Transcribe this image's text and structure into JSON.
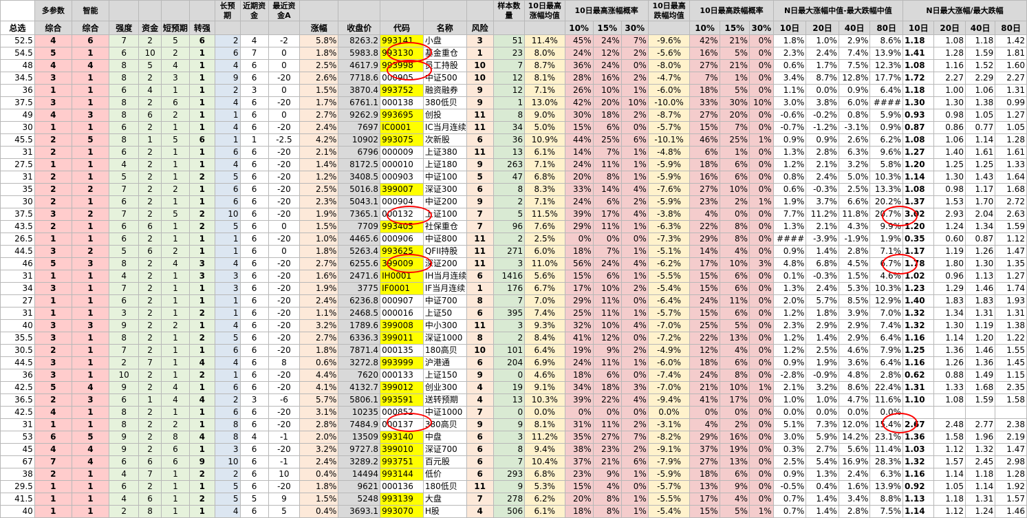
{
  "header": {
    "duo": "多参数",
    "zhineng": "智能",
    "changyuqi": "长预期",
    "jinqizijin": "近期资金",
    "zuijinzijin": "最近资金A",
    "zhangfu": "涨幅",
    "shoupanjia": "收盘价",
    "daima": "代码",
    "mingcheng": "名称",
    "fengxian": "风险",
    "yangben": "样本数量",
    "max_avg": "10日最高涨幅均值",
    "max_prob": "10日最高涨幅概率",
    "min_avg": "10日最高跌幅均值",
    "min_prob": "10日最高跌幅概率",
    "median": "N日最大涨幅中值-最大跌幅中值",
    "ratio": "N日最大涨幅/最大跌幅",
    "zongxuan": "总选",
    "zonghe": "综合",
    "qiangdu": "强度",
    "zijin": "资金",
    "duanyuqi": "短预期",
    "zhuanqiang": "转强",
    "p10": "10%",
    "p15": "15%",
    "p30": "30%",
    "d10": "10日",
    "d20": "20日",
    "d40": "40日",
    "d80": "80日"
  },
  "rows": [
    [
      "52.5",
      "4",
      "6",
      "7",
      "2",
      "5",
      "6",
      "2",
      "4",
      "-2",
      "5.8%",
      "8263.2",
      "993141",
      "小盘",
      "3",
      "51",
      "11.4%",
      "45%",
      "24%",
      "7%",
      "-9.6%",
      "42%",
      "21%",
      "0%",
      "1.8%",
      "1.0%",
      "2.9%",
      "8.6%",
      "1.18",
      "1.08",
      "1.18",
      "1.42"
    ],
    [
      "54.5",
      "5",
      "1",
      "6",
      "10",
      "2",
      "1",
      "6",
      "7",
      "0",
      "1.8%",
      "5983.8",
      "993130",
      "基金重仓",
      "1",
      "23",
      "8.0%",
      "24%",
      "12%",
      "2%",
      "-5.6%",
      "16%",
      "5%",
      "0%",
      "2.3%",
      "2.4%",
      "7.4%",
      "13.9%",
      "1.41",
      "1.28",
      "1.59",
      "1.81"
    ],
    [
      "48",
      "4",
      "4",
      "8",
      "5",
      "4",
      "1",
      "4",
      "6",
      "0",
      "2.5%",
      "4617.9",
      "993998",
      "员工持股",
      "10",
      "7",
      "8.7%",
      "36%",
      "24%",
      "0%",
      "-8.0%",
      "27%",
      "21%",
      "0%",
      "0.6%",
      "1.7%",
      "7.5%",
      "12.3%",
      "1.08",
      "1.16",
      "1.52",
      "1.60"
    ],
    [
      "34.5",
      "3",
      "1",
      "8",
      "2",
      "3",
      "1",
      "9",
      "6",
      "-20",
      "2.6%",
      "7718.6",
      "000905",
      "中证500",
      "10",
      "12",
      "8.1%",
      "28%",
      "16%",
      "2%",
      "-4.7%",
      "7%",
      "1%",
      "0%",
      "3.4%",
      "8.7%",
      "12.8%",
      "17.7%",
      "1.72",
      "2.27",
      "2.29",
      "2.27"
    ],
    [
      "36",
      "1",
      "1",
      "6",
      "4",
      "1",
      "1",
      "2",
      "3",
      "0",
      "1.5%",
      "3870.4",
      "993752",
      "融资融券",
      "9",
      "12",
      "7.1%",
      "26%",
      "10%",
      "1%",
      "-6.0%",
      "18%",
      "5%",
      "0%",
      "1.1%",
      "0.0%",
      "0.9%",
      "6.4%",
      "1.18",
      "1.00",
      "1.06",
      "1.31"
    ],
    [
      "37.5",
      "3",
      "1",
      "8",
      "2",
      "6",
      "1",
      "4",
      "6",
      "-20",
      "1.7%",
      "6761.1",
      "000138",
      "380低贝",
      "9",
      "1",
      "13.0%",
      "42%",
      "20%",
      "10%",
      "-10.0%",
      "33%",
      "30%",
      "10%",
      "3.0%",
      "3.8%",
      "6.0%",
      "####",
      "1.30",
      "1.30",
      "1.38",
      "0.99"
    ],
    [
      "49",
      "4",
      "3",
      "8",
      "6",
      "2",
      "1",
      "1",
      "6",
      "0",
      "2.7%",
      "9262.9",
      "993695",
      "创投",
      "11",
      "8",
      "9.0%",
      "30%",
      "18%",
      "2%",
      "-8.7%",
      "27%",
      "20%",
      "0%",
      "-0.6%",
      "-0.2%",
      "0.8%",
      "5.9%",
      "0.93",
      "0.98",
      "1.05",
      "1.27"
    ],
    [
      "30",
      "1",
      "1",
      "6",
      "2",
      "1",
      "1",
      "4",
      "6",
      "-20",
      "2.4%",
      "7697",
      "IC0001",
      "IC当月连续",
      "11",
      "34",
      "5.0%",
      "15%",
      "6%",
      "0%",
      "-5.7%",
      "15%",
      "7%",
      "0%",
      "-0.7%",
      "-1.2%",
      "-3.1%",
      "0.9%",
      "0.87",
      "0.86",
      "0.77",
      "1.05"
    ],
    [
      "45.5",
      "2",
      "5",
      "8",
      "1",
      "5",
      "6",
      "1",
      "1",
      "-2.5",
      "4.2%",
      "10902",
      "993075",
      "次新股",
      "6",
      "36",
      "10.9%",
      "44%",
      "25%",
      "6%",
      "-10.1%",
      "46%",
      "25%",
      "1%",
      "0.9%",
      "0.9%",
      "2.6%",
      "6.2%",
      "1.08",
      "1.06",
      "1.14",
      "1.28"
    ],
    [
      "31",
      "2",
      "1",
      "6",
      "2",
      "1",
      "1",
      "6",
      "6",
      "-20",
      "2.1%",
      "6796",
      "000009",
      "上证380",
      "11",
      "13",
      "6.1%",
      "14%",
      "7%",
      "1%",
      "-4.8%",
      "6%",
      "1%",
      "0%",
      "1.3%",
      "2.8%",
      "6.3%",
      "9.6%",
      "1.27",
      "1.40",
      "1.61",
      "1.61"
    ],
    [
      "27.5",
      "1",
      "1",
      "4",
      "2",
      "1",
      "1",
      "4",
      "6",
      "-20",
      "1.4%",
      "8172.5",
      "000010",
      "上证180",
      "9",
      "263",
      "7.1%",
      "24%",
      "11%",
      "1%",
      "-5.9%",
      "18%",
      "6%",
      "0%",
      "1.2%",
      "2.1%",
      "3.2%",
      "5.8%",
      "1.20",
      "1.25",
      "1.25",
      "1.33"
    ],
    [
      "31",
      "2",
      "1",
      "5",
      "2",
      "1",
      "2",
      "5",
      "6",
      "-20",
      "1.2%",
      "3408.5",
      "000903",
      "中证100",
      "5",
      "47",
      "6.8%",
      "20%",
      "8%",
      "1%",
      "-5.9%",
      "16%",
      "6%",
      "0%",
      "0.8%",
      "2.4%",
      "5.0%",
      "10.3%",
      "1.14",
      "1.30",
      "1.43",
      "1.64"
    ],
    [
      "35",
      "2",
      "2",
      "7",
      "2",
      "2",
      "1",
      "6",
      "6",
      "-20",
      "2.5%",
      "5016.8",
      "399007",
      "深证300",
      "6",
      "8",
      "8.3%",
      "33%",
      "14%",
      "4%",
      "-7.6%",
      "27%",
      "10%",
      "0%",
      "0.6%",
      "-0.3%",
      "2.5%",
      "13.3%",
      "1.08",
      "0.98",
      "1.17",
      "1.68"
    ],
    [
      "30",
      "2",
      "1",
      "6",
      "2",
      "1",
      "1",
      "6",
      "6",
      "-20",
      "2.3%",
      "5043.1",
      "000904",
      "中证200",
      "9",
      "2",
      "7.1%",
      "24%",
      "6%",
      "2%",
      "-5.9%",
      "23%",
      "2%",
      "1%",
      "1.9%",
      "3.7%",
      "6.6%",
      "20.2%",
      "1.37",
      "1.53",
      "1.70",
      "2.72"
    ],
    [
      "37.5",
      "3",
      "2",
      "7",
      "2",
      "5",
      "2",
      "10",
      "6",
      "-20",
      "1.9%",
      "7365.1",
      "000132",
      "上证100",
      "7",
      "5",
      "11.5%",
      "39%",
      "17%",
      "4%",
      "-3.8%",
      "4%",
      "0%",
      "0%",
      "7.7%",
      "11.2%",
      "11.8%",
      "20.7%",
      "3.02",
      "2.93",
      "2.04",
      "2.63"
    ],
    [
      "43.5",
      "2",
      "1",
      "6",
      "6",
      "1",
      "2",
      "5",
      "6",
      "0",
      "1.5%",
      "7709",
      "993405",
      "社保重仓",
      "7",
      "96",
      "7.6%",
      "29%",
      "11%",
      "1%",
      "-6.3%",
      "22%",
      "8%",
      "0%",
      "1.3%",
      "2.1%",
      "4.3%",
      "9.9%",
      "1.20",
      "1.24",
      "1.34",
      "1.59"
    ],
    [
      "26.5",
      "1",
      "1",
      "6",
      "2",
      "1",
      "1",
      "1",
      "6",
      "-20",
      "1.0%",
      "4465.6",
      "000906",
      "中证800",
      "11",
      "2",
      "2.5%",
      "0%",
      "0%",
      "0%",
      "-7.3%",
      "29%",
      "8%",
      "0%",
      "####",
      "-3.9%",
      "-1.9%",
      "1.9%",
      "0.35",
      "0.60",
      "0.87",
      "1.12"
    ],
    [
      "44.5",
      "3",
      "2",
      "5",
      "6",
      "2",
      "1",
      "1",
      "6",
      "0",
      "1.8%",
      "5263.4",
      "993625",
      "QFII持股",
      "11",
      "271",
      "6.0%",
      "18%",
      "7%",
      "1%",
      "-5.1%",
      "14%",
      "4%",
      "0%",
      "0.9%",
      "1.4%",
      "2.8%",
      "7.1%",
      "1.17",
      "1.19",
      "1.26",
      "1.47"
    ],
    [
      "46",
      "5",
      "3",
      "8",
      "2",
      "4",
      "3",
      "4",
      "6",
      "-20",
      "2.7%",
      "6255.6",
      "399009",
      "深证200",
      "11",
      "3",
      "11.0%",
      "56%",
      "24%",
      "4%",
      "-6.2%",
      "17%",
      "10%",
      "3%",
      "4.8%",
      "6.8%",
      "4.5%",
      "6.7%",
      "1.78",
      "1.80",
      "1.30",
      "1.35"
    ],
    [
      "31",
      "1",
      "1",
      "4",
      "2",
      "1",
      "3",
      "3",
      "6",
      "-20",
      "1.6%",
      "2471.6",
      "IH0001",
      "IH当月连续",
      "6",
      "1416",
      "5.6%",
      "15%",
      "6%",
      "1%",
      "-5.5%",
      "15%",
      "6%",
      "0%",
      "0.1%",
      "-0.3%",
      "1.5%",
      "4.6%",
      "1.02",
      "0.96",
      "1.13",
      "1.27"
    ],
    [
      "34",
      "3",
      "1",
      "7",
      "2",
      "1",
      "1",
      "3",
      "6",
      "-20",
      "1.9%",
      "3775",
      "IF0001",
      "IF当月连续",
      "1",
      "176",
      "6.7%",
      "17%",
      "10%",
      "2%",
      "-5.4%",
      "15%",
      "6%",
      "0%",
      "1.3%",
      "2.4%",
      "5.3%",
      "10.3%",
      "1.23",
      "1.29",
      "1.46",
      "1.74"
    ],
    [
      "27",
      "1",
      "1",
      "6",
      "2",
      "1",
      "1",
      "1",
      "6",
      "-20",
      "2.4%",
      "6236.8",
      "000907",
      "中证700",
      "8",
      "7",
      "7.0%",
      "29%",
      "11%",
      "0%",
      "-6.4%",
      "24%",
      "11%",
      "0%",
      "2.0%",
      "5.7%",
      "8.5%",
      "12.9%",
      "1.40",
      "1.83",
      "1.83",
      "1.93"
    ],
    [
      "31",
      "1",
      "1",
      "3",
      "2",
      "1",
      "2",
      "1",
      "6",
      "-20",
      "1.1%",
      "2468.5",
      "000016",
      "上证50",
      "6",
      "395",
      "7.4%",
      "25%",
      "11%",
      "1%",
      "-5.7%",
      "15%",
      "6%",
      "0%",
      "1.2%",
      "1.8%",
      "3.9%",
      "7.0%",
      "1.32",
      "1.34",
      "1.31",
      "1.31"
    ],
    [
      "40",
      "3",
      "3",
      "9",
      "2",
      "2",
      "1",
      "4",
      "6",
      "-20",
      "3.2%",
      "1789.6",
      "399008",
      "中小300",
      "11",
      "3",
      "9.3%",
      "32%",
      "10%",
      "4%",
      "-7.0%",
      "25%",
      "5%",
      "0%",
      "2.3%",
      "2.9%",
      "2.9%",
      "7.4%",
      "1.32",
      "1.30",
      "1.19",
      "1.38"
    ],
    [
      "35.5",
      "3",
      "1",
      "8",
      "2",
      "1",
      "2",
      "5",
      "6",
      "-20",
      "2.7%",
      "6336.3",
      "399011",
      "深证1000",
      "8",
      "2",
      "8.4%",
      "41%",
      "12%",
      "0%",
      "-7.2%",
      "22%",
      "13%",
      "0%",
      "1.2%",
      "1.4%",
      "2.9%",
      "6.4%",
      "1.16",
      "1.14",
      "1.20",
      "1.22"
    ],
    [
      "30.5",
      "2",
      "1",
      "7",
      "2",
      "1",
      "1",
      "6",
      "6",
      "-20",
      "1.8%",
      "7871.4",
      "000135",
      "180高贝",
      "10",
      "101",
      "6.4%",
      "19%",
      "9%",
      "2%",
      "-4.9%",
      "12%",
      "4%",
      "0%",
      "1.2%",
      "2.5%",
      "4.6%",
      "7.9%",
      "1.25",
      "1.36",
      "1.46",
      "1.55"
    ],
    [
      "44.5",
      "3",
      "1",
      "2",
      "7",
      "1",
      "4",
      "4",
      "6",
      "8",
      "0.6%",
      "3272.8",
      "993999",
      "沪港通",
      "6",
      "204",
      "6.9%",
      "24%",
      "11%",
      "1%",
      "-6.0%",
      "18%",
      "6%",
      "0%",
      "0.9%",
      "1.9%",
      "3.6%",
      "6.4%",
      "1.16",
      "1.26",
      "1.36",
      "1.45"
    ],
    [
      "36",
      "3",
      "1",
      "10",
      "2",
      "1",
      "2",
      "1",
      "6",
      "-20",
      "4.4%",
      "7620",
      "000133",
      "上证150",
      "9",
      "0",
      "4.6%",
      "18%",
      "6%",
      "0%",
      "-7.4%",
      "24%",
      "8%",
      "0%",
      "-2.8%",
      "-0.9%",
      "4.8%",
      "2.8%",
      "0.62",
      "0.88",
      "1.49",
      "1.15"
    ],
    [
      "42.5",
      "5",
      "4",
      "9",
      "2",
      "4",
      "1",
      "6",
      "6",
      "-20",
      "4.1%",
      "4132.7",
      "399012",
      "创业300",
      "4",
      "19",
      "9.1%",
      "34%",
      "18%",
      "3%",
      "-7.0%",
      "21%",
      "10%",
      "1%",
      "2.1%",
      "3.2%",
      "8.6%",
      "22.4%",
      "1.31",
      "1.33",
      "1.68",
      "2.35"
    ],
    [
      "36.5",
      "2",
      "3",
      "6",
      "1",
      "4",
      "4",
      "2",
      "3",
      "-6",
      "5.7%",
      "5806.1",
      "993591",
      "送转预期",
      "4",
      "13",
      "10.3%",
      "39%",
      "22%",
      "4%",
      "-9.4%",
      "41%",
      "17%",
      "0%",
      "1.0%",
      "1.0%",
      "4.7%",
      "11.6%",
      "1.10",
      "1.08",
      "1.59",
      "1.58"
    ],
    [
      "42.5",
      "4",
      "1",
      "8",
      "2",
      "1",
      "1",
      "6",
      "6",
      "-20",
      "3.1%",
      "10235",
      "000852",
      "中证1000",
      "7",
      "0",
      "0.0%",
      "0%",
      "0%",
      "0%",
      "0.0%",
      "0%",
      "0%",
      "0%",
      "0.0%",
      "0.0%",
      "0.0%",
      "0.0%",
      "",
      "",
      "",
      ""
    ],
    [
      "31",
      "1",
      "1",
      "8",
      "2",
      "2",
      "1",
      "8",
      "6",
      "-20",
      "2.8%",
      "7484.9",
      "000137",
      "380高贝",
      "9",
      "9",
      "8.1%",
      "31%",
      "11%",
      "2%",
      "-3.1%",
      "4%",
      "2%",
      "0%",
      "5.1%",
      "7.3%",
      "12.0%",
      "15.4%",
      "2.67",
      "2.48",
      "2.77",
      "2.38"
    ],
    [
      "53",
      "6",
      "5",
      "9",
      "2",
      "8",
      "4",
      "8",
      "4",
      "-1",
      "2.0%",
      "13509",
      "993140",
      "中盘",
      "6",
      "3",
      "11.2%",
      "35%",
      "27%",
      "7%",
      "-8.2%",
      "29%",
      "16%",
      "0%",
      "3.0%",
      "5.9%",
      "14.2%",
      "23.1%",
      "1.36",
      "1.58",
      "1.96",
      "2.19"
    ],
    [
      "45",
      "4",
      "4",
      "9",
      "2",
      "6",
      "1",
      "3",
      "6",
      "-20",
      "3.2%",
      "9727.8",
      "399010",
      "深证700",
      "6",
      "8",
      "9.4%",
      "38%",
      "23%",
      "2%",
      "-9.1%",
      "37%",
      "19%",
      "0%",
      "0.3%",
      "2.7%",
      "5.6%",
      "11.4%",
      "1.03",
      "1.12",
      "1.32",
      "1.47"
    ],
    [
      "67",
      "7",
      "4",
      "6",
      "6",
      "6",
      "9",
      "10",
      "6",
      "-1",
      "2.4%",
      "3289.2",
      "993751",
      "百元股",
      "6",
      "7",
      "10.4%",
      "37%",
      "21%",
      "6%",
      "-7.9%",
      "27%",
      "13%",
      "0%",
      "2.5%",
      "5.4%",
      "16.9%",
      "28.3%",
      "1.32",
      "1.57",
      "2.45",
      "2.98"
    ],
    [
      "38",
      "2",
      "1",
      "4",
      "7",
      "1",
      "2",
      "2",
      "6",
      "10",
      "0.4%",
      "14494",
      "993144",
      "低价",
      "6",
      "293",
      "6.8%",
      "23%",
      "9%",
      "1%",
      "-5.9%",
      "18%",
      "6%",
      "0%",
      "0.9%",
      "1.3%",
      "2.4%",
      "6.3%",
      "1.16",
      "1.14",
      "1.18",
      "1.28"
    ],
    [
      "29.5",
      "1",
      "1",
      "6",
      "2",
      "1",
      "1",
      "5",
      "6",
      "-20",
      "1.8%",
      "9621",
      "000136",
      "180低贝",
      "11",
      "9",
      "5.3%",
      "15%",
      "4%",
      "0%",
      "-5.7%",
      "13%",
      "9%",
      "0%",
      "-0.5%",
      "0.4%",
      "1.6%",
      "13.9%",
      "0.92",
      "1.05",
      "1.14",
      "1.92"
    ],
    [
      "41.5",
      "1",
      "1",
      "4",
      "6",
      "1",
      "2",
      "5",
      "5",
      "9",
      "1.5%",
      "5248",
      "993139",
      "大盘",
      "7",
      "278",
      "6.2%",
      "20%",
      "8%",
      "1%",
      "-5.5%",
      "17%",
      "4%",
      "0%",
      "0.7%",
      "1.4%",
      "3.4%",
      "8.8%",
      "1.13",
      "1.18",
      "1.31",
      "1.57"
    ],
    [
      "40",
      "1",
      "1",
      "2",
      "8",
      "1",
      "1",
      "4",
      "6",
      "5",
      "0.4%",
      "3693.1",
      "993070",
      "H股",
      "4",
      "506",
      "6.1%",
      "18%",
      "8%",
      "1%",
      "-5.4%",
      "15%",
      "5%",
      "1%",
      "0.7%",
      "1.4%",
      "2.8%",
      "7.5%",
      "1.14",
      "1.12",
      "1.24",
      "1.46"
    ]
  ]
}
